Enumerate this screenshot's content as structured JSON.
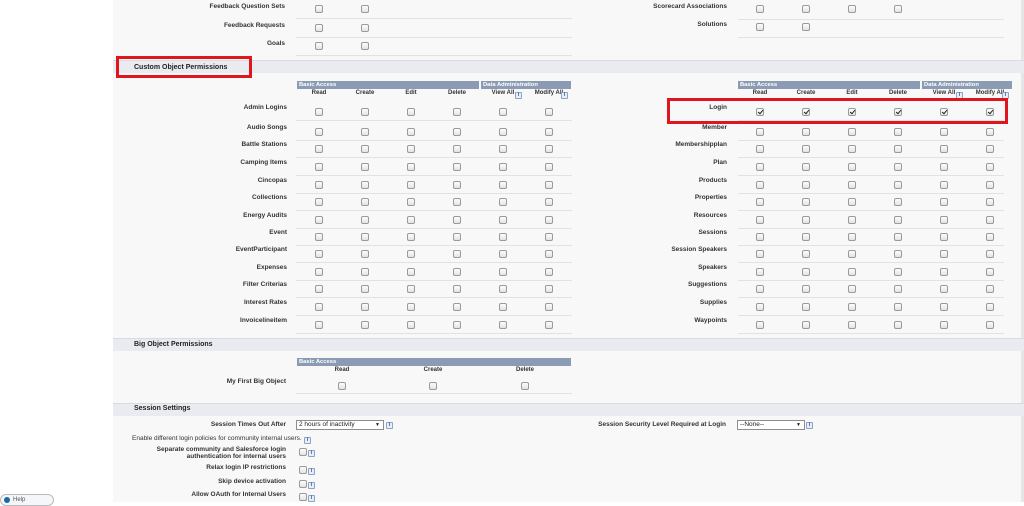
{
  "help_tab": {
    "label": "Help"
  },
  "top_rows": {
    "left": [
      {
        "label": "Feedback Question Sets"
      },
      {
        "label": "Feedback Requests"
      },
      {
        "label": "Goals"
      }
    ],
    "right": [
      {
        "label": "Scorecard Associations",
        "boxes": 4
      },
      {
        "label": "Solutions",
        "boxes": 2
      }
    ]
  },
  "custom_object_permissions": {
    "title": "Custom Object Permissions",
    "group_basic": "Basic Access",
    "group_admin": "Data Administration",
    "columns": [
      "Read",
      "Create",
      "Edit",
      "Delete",
      "View All",
      "Modify All"
    ],
    "left_rows": [
      "Admin Logins",
      "Audio Songs",
      "Battle Stations",
      "Camping Items",
      "Cincopas",
      "Collections",
      "Energy Audits",
      "Event",
      "EventParticipant",
      "Expenses",
      "Filter Criterias",
      "Interest Rates",
      "Invoicelineitem"
    ],
    "right_rows": [
      {
        "label": "Login",
        "checked": [
          true,
          true,
          true,
          true,
          true,
          true
        ]
      },
      {
        "label": "Member",
        "checked": [
          false,
          false,
          false,
          false,
          false,
          false
        ]
      },
      {
        "label": "Membershipplan",
        "checked": [
          false,
          false,
          false,
          false,
          false,
          false
        ]
      },
      {
        "label": "Plan",
        "checked": [
          false,
          false,
          false,
          false,
          false,
          false
        ]
      },
      {
        "label": "Products",
        "checked": [
          false,
          false,
          false,
          false,
          false,
          false
        ]
      },
      {
        "label": "Properties",
        "checked": [
          false,
          false,
          false,
          false,
          false,
          false
        ]
      },
      {
        "label": "Resources",
        "checked": [
          false,
          false,
          false,
          false,
          false,
          false
        ]
      },
      {
        "label": "Sessions",
        "checked": [
          false,
          false,
          false,
          false,
          false,
          false
        ]
      },
      {
        "label": "Session Speakers",
        "checked": [
          false,
          false,
          false,
          false,
          false,
          false
        ]
      },
      {
        "label": "Speakers",
        "checked": [
          false,
          false,
          false,
          false,
          false,
          false
        ]
      },
      {
        "label": "Suggestions",
        "checked": [
          false,
          false,
          false,
          false,
          false,
          false
        ]
      },
      {
        "label": "Supplies",
        "checked": [
          false,
          false,
          false,
          false,
          false,
          false
        ]
      },
      {
        "label": "Waypoints",
        "checked": [
          false,
          false,
          false,
          false,
          false,
          false
        ]
      }
    ]
  },
  "big_object_permissions": {
    "title": "Big Object Permissions",
    "group_basic": "Basic Access",
    "columns": [
      "Read",
      "Create",
      "Delete"
    ],
    "rows": [
      "My First Big Object"
    ]
  },
  "session_settings": {
    "title": "Session Settings",
    "timeout_label": "Session Times Out After",
    "timeout_value": "2 hours of inactivity",
    "security_label": "Session Security Level Required at Login",
    "security_value": "--None--",
    "community_label": "Enable different login policies for community internal users.",
    "options": [
      {
        "label": "Separate community and Salesforce login authentication for internal users"
      },
      {
        "label": "Relax login IP restrictions"
      },
      {
        "label": "Skip device activation"
      },
      {
        "label": "Allow OAuth for Internal Users"
      }
    ]
  },
  "colors": {
    "highlight": "#e0161f",
    "group_header": "#8a9bb3",
    "section_bg": "#e9ebf0"
  }
}
